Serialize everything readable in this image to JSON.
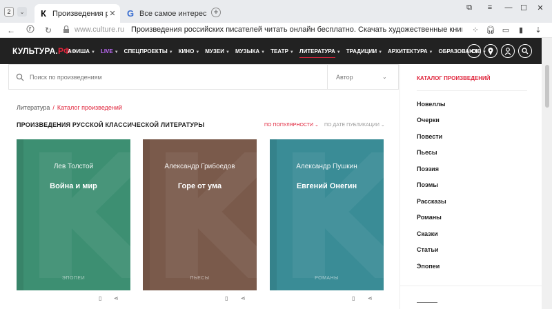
{
  "browser": {
    "tab_count": "2",
    "tabs": [
      {
        "title": "Произведения российс",
        "favicon": "К"
      },
      {
        "title": "Все самое интересное из",
        "favicon": "G"
      }
    ],
    "url": "www.culture.ru",
    "page_title": "Произведения российских писателей читать онлайн бесплатно. Скачать художественные книги русск..."
  },
  "site": {
    "logo_main": "КУЛЬТУРА.",
    "logo_suffix": "РФ",
    "nav": [
      {
        "label": "АФИША"
      },
      {
        "label": "LIVE"
      },
      {
        "label": "СПЕЦПРОЕКТЫ"
      },
      {
        "label": "КИНО"
      },
      {
        "label": "МУЗЕИ"
      },
      {
        "label": "МУЗЫКА"
      },
      {
        "label": "ТЕАТР"
      },
      {
        "label": "ЛИТЕРАТУРА"
      },
      {
        "label": "ТРАДИЦИИ"
      },
      {
        "label": "АРХИТЕКТУРА"
      },
      {
        "label": "ОБРАЗОВАНИЕ"
      }
    ]
  },
  "search": {
    "placeholder": "Поиск по произведениям",
    "author_label": "Автор"
  },
  "breadcrumb": {
    "root": "Литература",
    "separator": "/",
    "current": "Каталог произведений"
  },
  "section": {
    "title": "ПРОИЗВЕДЕНИЯ РУССКОЙ КЛАССИЧЕСКОЙ ЛИТЕРАТУРЫ",
    "sort_popular": "ПО ПОПУЛЯРНОСТИ",
    "sort_date": "ПО ДАТЕ ПУБЛИКАЦИИ"
  },
  "cards": [
    {
      "author": "Лев Толстой",
      "title": "Война и мир",
      "genre": "ЭПОПЕИ",
      "color": "#3d8f72"
    },
    {
      "author": "Александр Грибоедов",
      "title": "Горе от ума",
      "genre": "ПЬЕСЫ",
      "color": "#7a5a4b"
    },
    {
      "author": "Александр Пушкин",
      "title": "Евгений Онегин",
      "genre": "РОМАНЫ",
      "color": "#3a8c96"
    }
  ],
  "sidebar": {
    "title": "КАТАЛОГ ПРОИЗВЕДЕНИЙ",
    "items": [
      "Новеллы",
      "Очерки",
      "Повести",
      "Пьесы",
      "Поэзия",
      "Поэмы",
      "Рассказы",
      "Романы",
      "Сказки",
      "Статьи",
      "Эпопеи"
    ]
  },
  "colors": {
    "accent_red": "#e0243b",
    "nav_bg": "#222222",
    "live_purple": "#c36cff"
  }
}
